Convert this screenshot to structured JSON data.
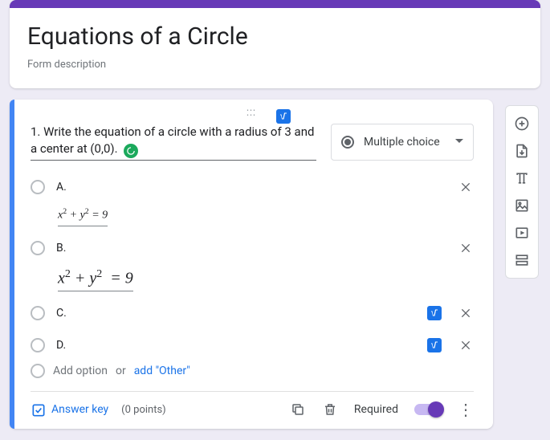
{
  "header": {
    "title": "Equations of a Circle",
    "description": "Form description"
  },
  "question": {
    "text": "1. Write the equation of a circle with a radius of 3 and a center at (0,0).",
    "type_label": "Multiple choice",
    "options": {
      "a": "A.",
      "b": "B.",
      "c": "C.",
      "d": "D."
    },
    "equations": {
      "a": "x² + y² = 9",
      "b": "x² + y²  = 9"
    },
    "add_option": "Add option",
    "or": "or",
    "add_other": "add \"Other\""
  },
  "footer": {
    "answer_key": "Answer key",
    "points": "(0 points)",
    "required": "Required"
  }
}
